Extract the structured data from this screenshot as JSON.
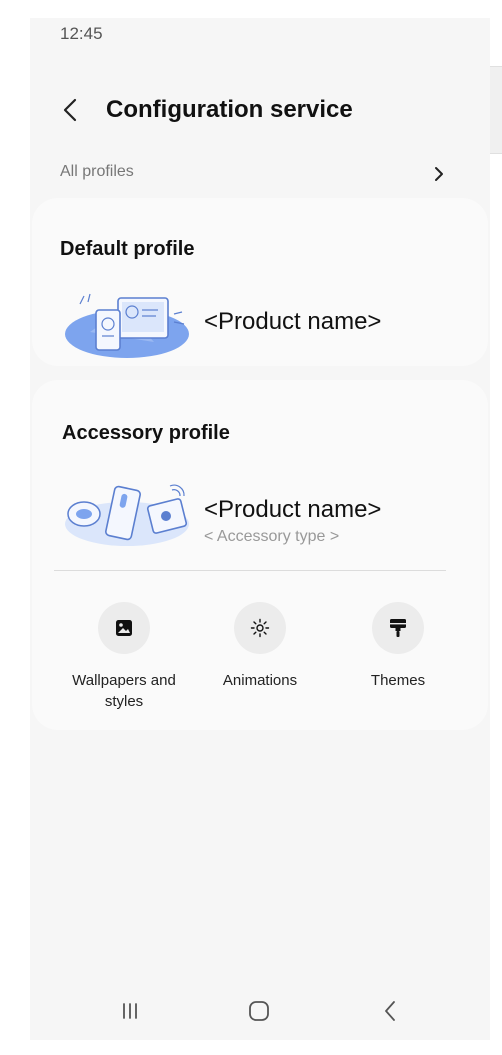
{
  "status_bar": {
    "time": "12:45"
  },
  "header": {
    "title": "Configuration service"
  },
  "all_profiles": {
    "label": "All profiles"
  },
  "default_profile": {
    "title": "Default profile",
    "product_name": "<Product name>"
  },
  "accessory_profile": {
    "title": "Accessory profile",
    "product_name": "<Product name>",
    "accessory_type": "< Accessory type >",
    "shortcuts": [
      {
        "label": "Wallpapers and styles",
        "icon": "wallpaper-icon"
      },
      {
        "label": "Animations",
        "icon": "animations-icon"
      },
      {
        "label": "Themes",
        "icon": "themes-brush-icon"
      }
    ]
  },
  "nav_bar": {
    "icons": [
      "recents-icon",
      "home-icon",
      "back-icon"
    ]
  },
  "colors": {
    "background": "#f6f6f6",
    "card": "#fafafa",
    "illustration_blue": "#7da4ee",
    "illustration_light": "#dbe6fb",
    "text_primary": "#111111",
    "text_secondary": "#777777"
  }
}
